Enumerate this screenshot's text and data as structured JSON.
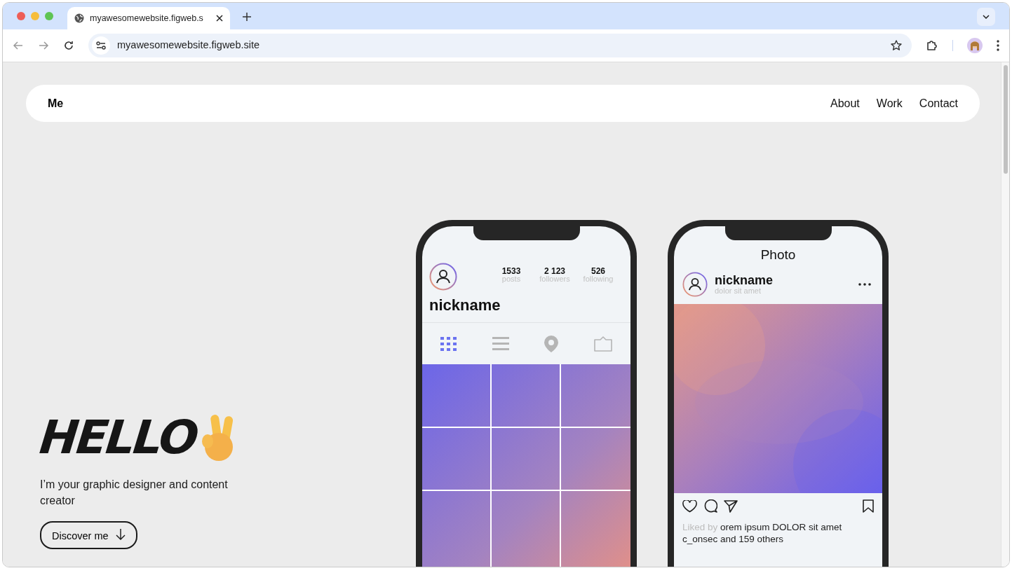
{
  "browser": {
    "tab_title": "myawesomewebsite.figweb.s",
    "url": "myawesomewebsite.figweb.site"
  },
  "nav": {
    "brand": "Me",
    "links": [
      "About",
      "Work",
      "Contact"
    ]
  },
  "hero": {
    "title": "HELLO",
    "subtitle": "I’m your graphic designer and content creator",
    "button": "Discover me"
  },
  "profile_phone": {
    "stats": [
      {
        "value": "1533",
        "label": "posts"
      },
      {
        "value": "2 123",
        "label": "followers"
      },
      {
        "value": "526",
        "label": "following"
      }
    ],
    "nickname": "nickname",
    "tabs": [
      {
        "kind": "grid",
        "selected": true
      },
      {
        "kind": "list",
        "selected": false
      },
      {
        "kind": "pin",
        "selected": false
      },
      {
        "kind": "tag",
        "selected": false
      }
    ]
  },
  "post_phone": {
    "title": "Photo",
    "nickname": "nickname",
    "subtitle": "dolor sit amet",
    "liked_prefix": "Liked by",
    "liked_rest": "orem ipsum DOLOR sit amet c_onsec and 159 others"
  }
}
